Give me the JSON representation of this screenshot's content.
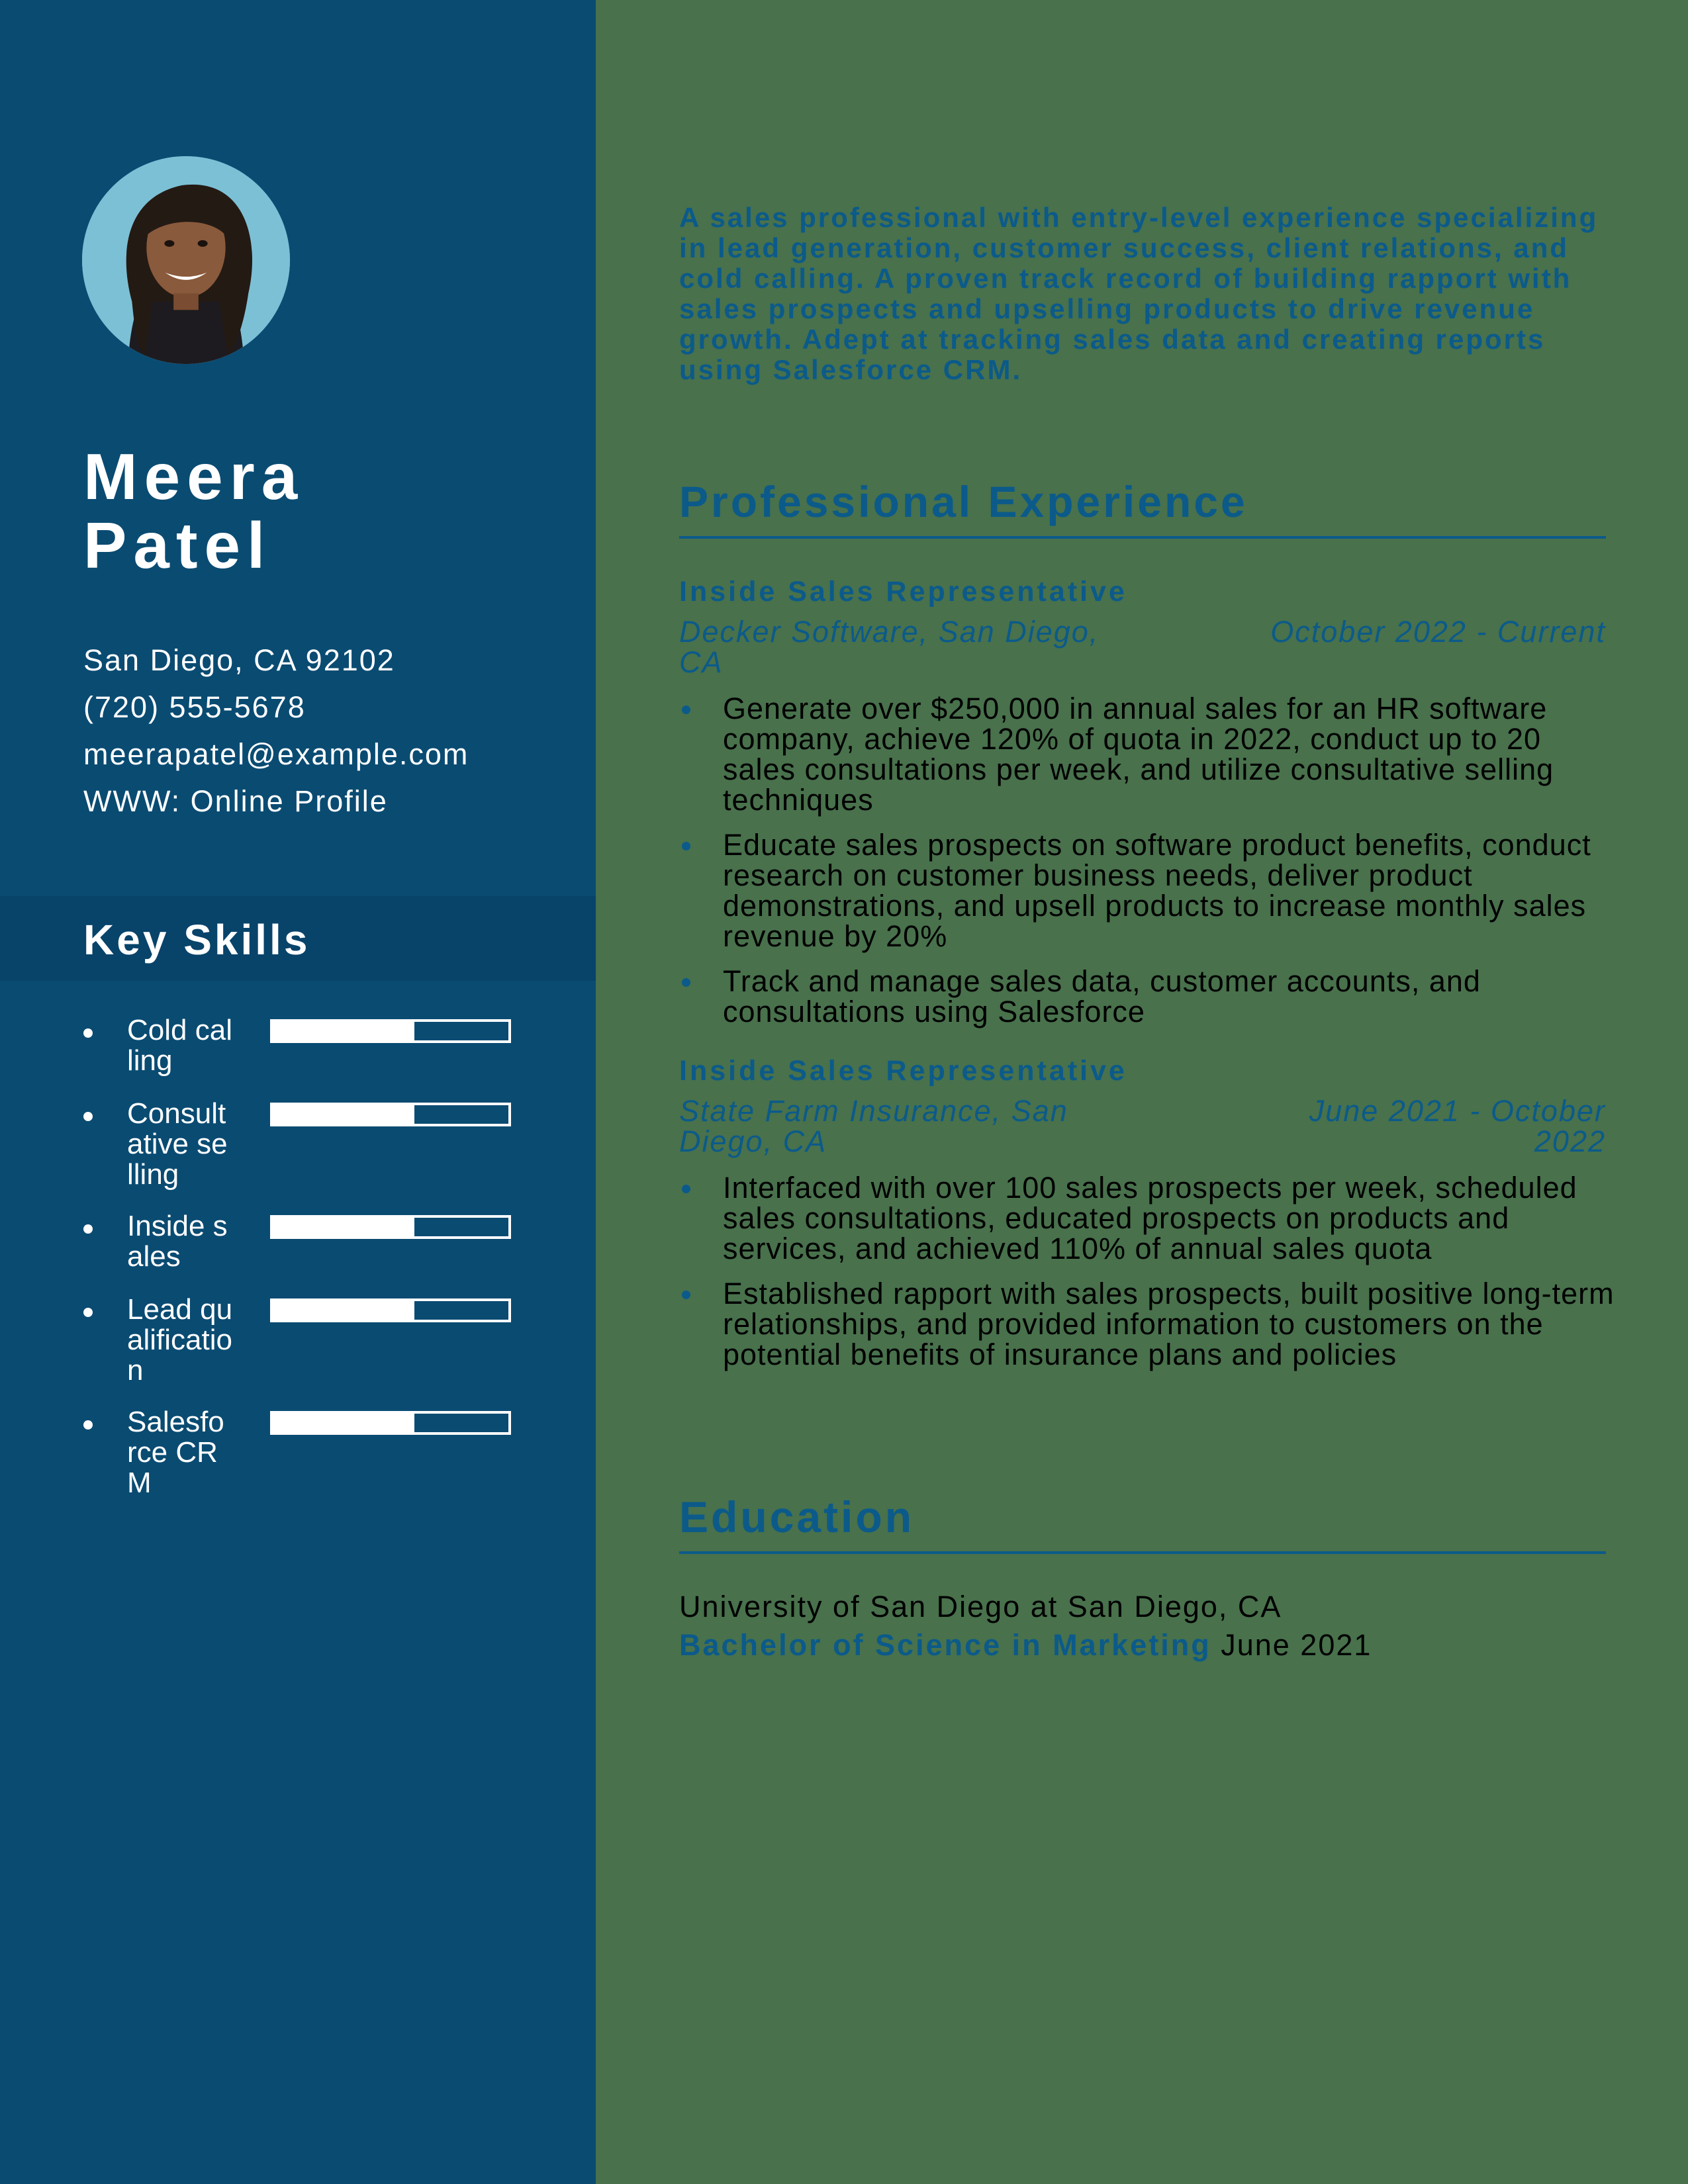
{
  "colors": {
    "sidebar": "#0a4b72",
    "main_background": "#48714c",
    "accent": "#0b5a8a",
    "text_dark": "#000000",
    "text_light": "#ffffff"
  },
  "profile": {
    "first_name": "Meera",
    "last_name": "Patel",
    "photo_icon": "portrait-photo"
  },
  "contact": {
    "address": "San Diego, CA 92102",
    "phone": "(720) 555-5678",
    "email": "meerapatel@example.com",
    "website": "WWW: Online Profile"
  },
  "skills": {
    "title": "Key Skills",
    "items": [
      {
        "label": "Cold calling",
        "level": 0.6
      },
      {
        "label": "Consultative selling",
        "level": 0.6
      },
      {
        "label": "Inside sales",
        "level": 0.6
      },
      {
        "label": "Lead qualification",
        "level": 0.6
      },
      {
        "label": "Salesforce CRM",
        "level": 0.6
      }
    ]
  },
  "summary": "A sales professional with entry-level experience specializing in lead generation, customer success, client relations, and cold calling. A proven track record of building rapport with sales prospects and upselling products to drive revenue growth. Adept at tracking sales data and creating reports using Salesforce CRM.",
  "experience": {
    "title": "Professional Experience",
    "jobs": [
      {
        "title": "Inside Sales Representative",
        "company": "Decker Software, San Diego, CA",
        "dates": "October 2022 - Current",
        "bullets": [
          "Generate over $250,000 in annual sales for an HR software company, achieve 120% of quota in 2022, conduct up to 20 sales consultations per week, and utilize consultative selling techniques",
          "Educate sales prospects on software product benefits, conduct research on customer business needs, deliver product demonstrations, and upsell products to increase monthly sales revenue by 20%",
          "Track and manage sales data, customer accounts, and consultations using Salesforce"
        ]
      },
      {
        "title": "Inside Sales Representative",
        "company": "State Farm Insurance, San Diego, CA",
        "dates": "June 2021 - October 2022",
        "bullets": [
          "Interfaced with over 100 sales prospects per week, scheduled sales consultations, educated prospects on products and services, and achieved 110% of annual sales quota",
          "Established rapport with sales prospects, built positive long-term relationships, and provided information to customers on the potential benefits of insurance plans and policies"
        ]
      }
    ]
  },
  "education": {
    "title": "Education",
    "school": "University of San Diego at San Diego, CA",
    "degree": "Bachelor of Science in Marketing",
    "date": "June 2021"
  }
}
